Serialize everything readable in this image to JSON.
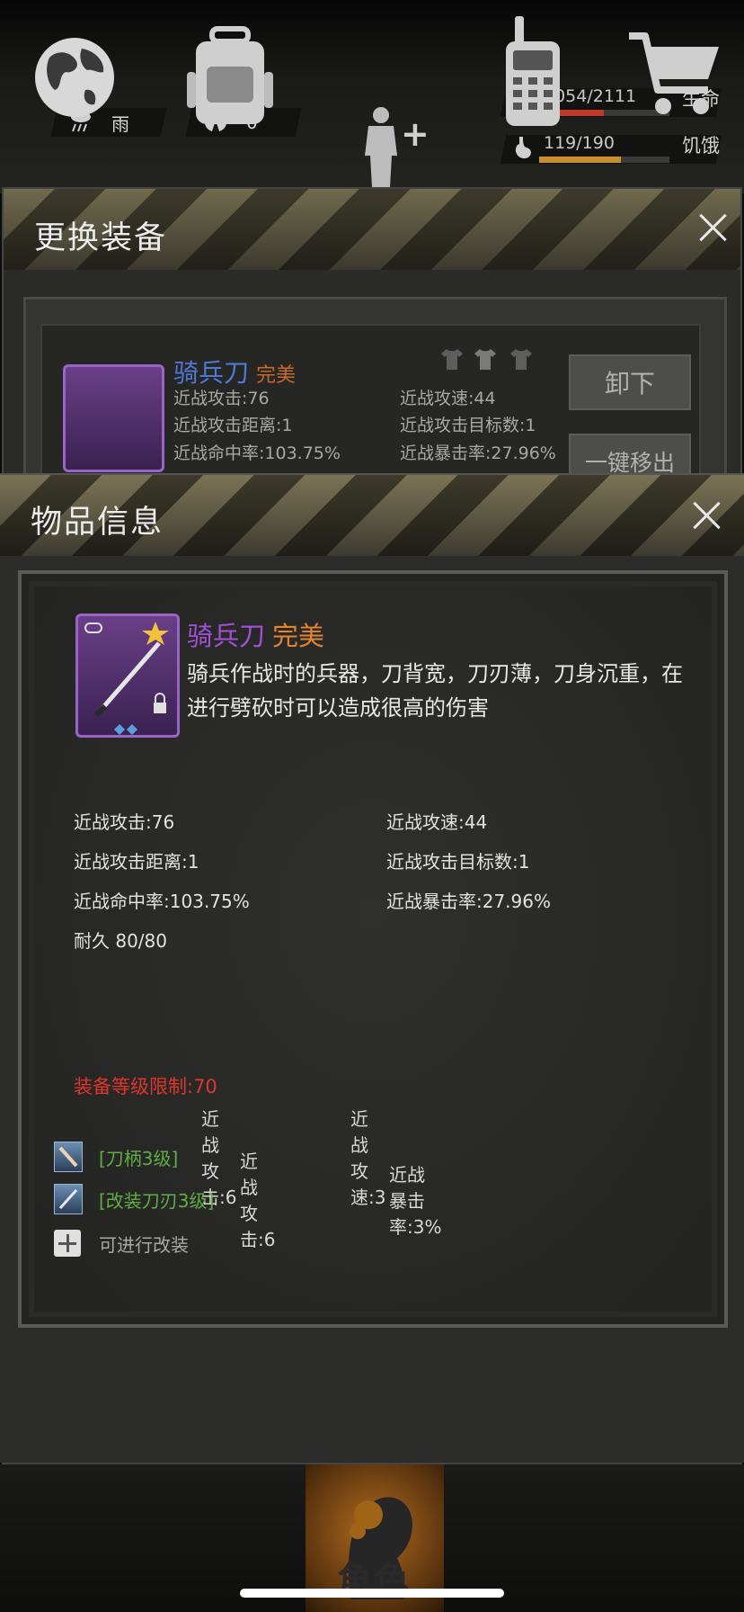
{
  "status_bar": {
    "weather_label": "雨",
    "radiation_value": "0",
    "health": {
      "value": "1054/2111",
      "label": "生命",
      "fraction": 0.499,
      "color": "#c0392b"
    },
    "hunger": {
      "value": "119/190",
      "label": "饥饿",
      "fraction": 0.626,
      "color": "#c8902a"
    }
  },
  "equip_panel": {
    "title": "更换装备",
    "item_name": "骑兵刀",
    "item_quality": "完美",
    "stats": [
      "近战攻击:76",
      "近战攻速:44",
      "近战攻击距离:1",
      "近战攻击目标数:1",
      "近战命中率:103.75%",
      "近战暴击率:27.96%"
    ],
    "unequip_button": "卸下",
    "remove_button": "一键移出"
  },
  "item_panel": {
    "title": "物品信息",
    "item_name": "骑兵刀",
    "item_quality": "完美",
    "description": "骑兵作战时的兵器，刀背宽，刀刃薄，刀身沉重，在进行劈砍时可以造成很高的伤害",
    "stats": {
      "melee_attack": "近战攻击:76",
      "melee_speed": "近战攻速:44",
      "melee_range": "近战攻击距离:1",
      "melee_targets": "近战攻击目标数:1",
      "melee_accuracy": "近战命中率:103.75%",
      "melee_crit": "近战暴击率:27.96%",
      "durability": "耐久 80/80"
    },
    "level_limit": "装备等级限制:70",
    "mods": [
      {
        "name": "[刀柄3级]",
        "stat1": "近战攻击:6",
        "stat2": "近战攻速:3"
      },
      {
        "name": "[改装刀刃3级]",
        "stat1": "近战攻击:6",
        "stat2": "近战暴击率:3%"
      }
    ],
    "add_mod_label": "可进行改装"
  },
  "bottom_nav": {
    "active_label": "角色",
    "items": [
      "globe-icon",
      "backpack-icon",
      "character-icon",
      "radio-icon",
      "cart-icon"
    ]
  }
}
